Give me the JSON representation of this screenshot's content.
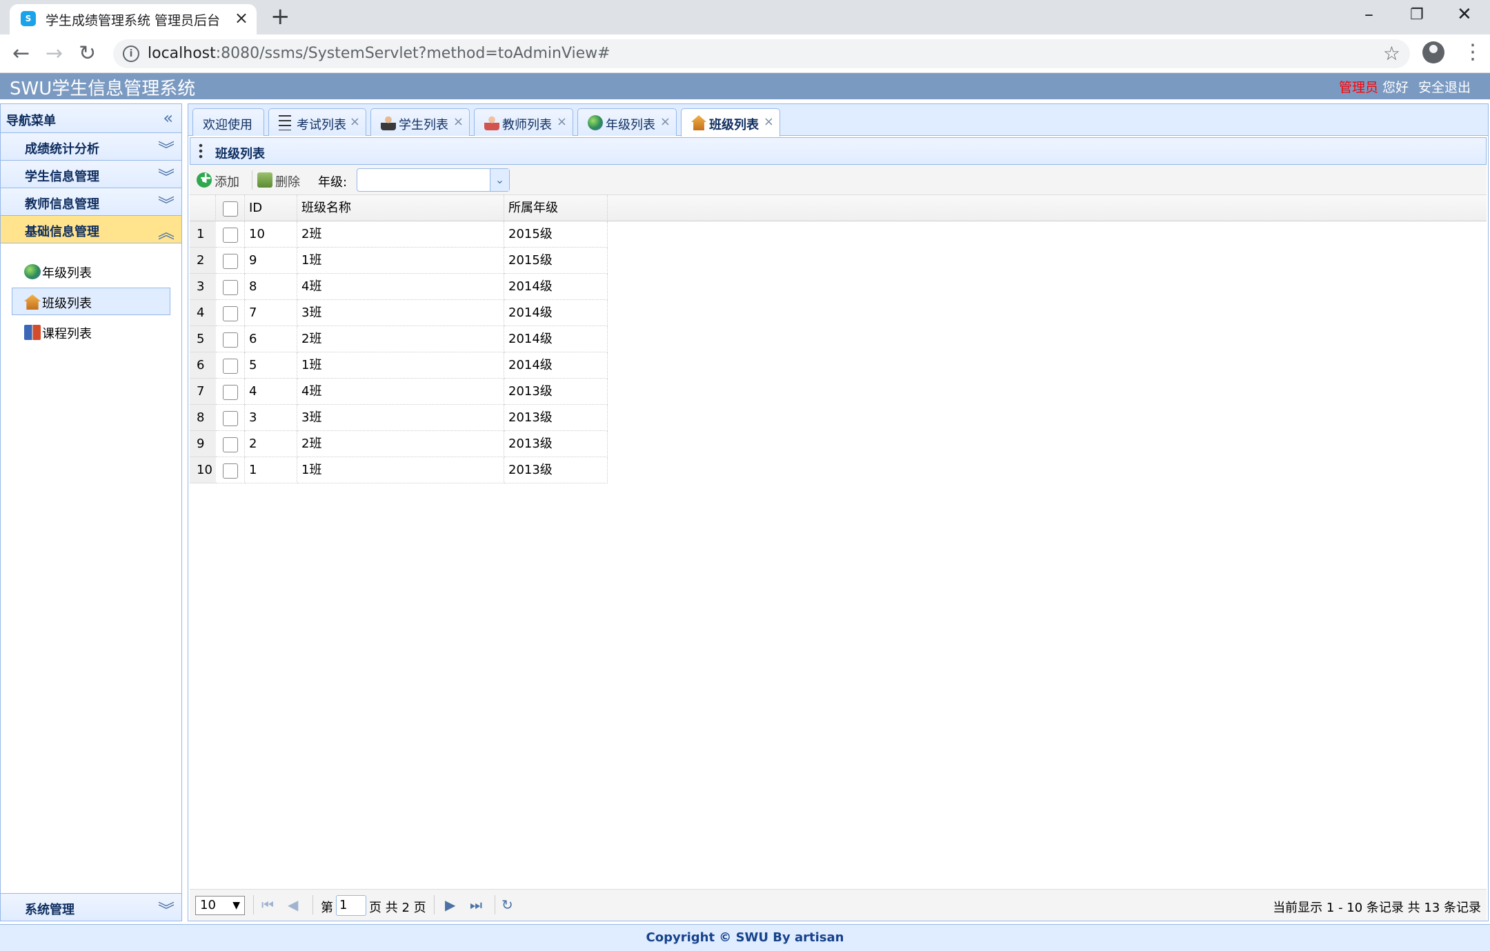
{
  "browser": {
    "tab_title": "学生成绩管理系统 管理员后台",
    "url_host": "localhost",
    "url_rest": ":8080/ssms/SystemServlet?method=toAdminView#"
  },
  "header": {
    "app_title": "SWU学生信息管理系统",
    "role": "管理员",
    "greeting": "您好",
    "logout": "安全退出"
  },
  "leftnav": {
    "title": "导航菜单",
    "sections": [
      {
        "label": "成绩统计分析"
      },
      {
        "label": "学生信息管理"
      },
      {
        "label": "教师信息管理"
      },
      {
        "label": "基础信息管理"
      }
    ],
    "items": [
      {
        "label": "年级列表",
        "icon": "globe-icon"
      },
      {
        "label": "班级列表",
        "icon": "house-icon"
      },
      {
        "label": "课程列表",
        "icon": "book-icon"
      }
    ],
    "bottom_section": "系统管理"
  },
  "tabs": [
    {
      "label": "欢迎使用"
    },
    {
      "label": "考试列表"
    },
    {
      "label": "学生列表"
    },
    {
      "label": "教师列表"
    },
    {
      "label": "年级列表"
    },
    {
      "label": "班级列表"
    }
  ],
  "panel": {
    "title": "班级列表",
    "add_label": "添加",
    "delete_label": "删除",
    "grade_filter_label": "年级:"
  },
  "grid": {
    "columns": [
      "ID",
      "班级名称",
      "所属年级"
    ],
    "rows": [
      {
        "num": "1",
        "id": "10",
        "name": "2班",
        "grade": "2015级"
      },
      {
        "num": "2",
        "id": "9",
        "name": "1班",
        "grade": "2015级"
      },
      {
        "num": "3",
        "id": "8",
        "name": "4班",
        "grade": "2014级"
      },
      {
        "num": "4",
        "id": "7",
        "name": "3班",
        "grade": "2014级"
      },
      {
        "num": "5",
        "id": "6",
        "name": "2班",
        "grade": "2014级"
      },
      {
        "num": "6",
        "id": "5",
        "name": "1班",
        "grade": "2014级"
      },
      {
        "num": "7",
        "id": "4",
        "name": "4班",
        "grade": "2013级"
      },
      {
        "num": "8",
        "id": "3",
        "name": "3班",
        "grade": "2013级"
      },
      {
        "num": "9",
        "id": "2",
        "name": "2班",
        "grade": "2013级"
      },
      {
        "num": "10",
        "id": "1",
        "name": "1班",
        "grade": "2013级"
      }
    ]
  },
  "pager": {
    "page_size": "10",
    "page_prefix": "第",
    "page_value": "1",
    "page_suffix": "页 共 2 页",
    "info": "当前显示 1 - 10 条记录 共 13 条记录"
  },
  "footer": {
    "text": "Copyright © SWU By artisan"
  }
}
